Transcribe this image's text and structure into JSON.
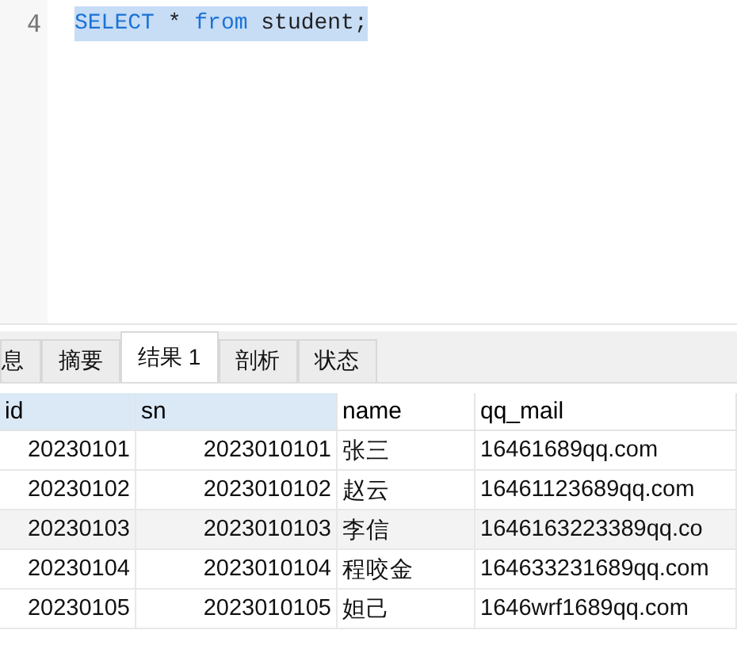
{
  "editor": {
    "lines": [
      {
        "number": "4",
        "tokens": [
          {
            "kind": "keyword",
            "text": "SELECT"
          },
          {
            "kind": "plain",
            "text": " * "
          },
          {
            "kind": "keyword",
            "text": "from"
          },
          {
            "kind": "plain",
            "text": " student;"
          }
        ],
        "selected": true
      }
    ]
  },
  "tabs": [
    {
      "label": "息",
      "selected": false
    },
    {
      "label": "摘要",
      "selected": false
    },
    {
      "label": "结果 1",
      "selected": true
    },
    {
      "label": "剖析",
      "selected": false
    },
    {
      "label": "状态",
      "selected": false
    }
  ],
  "table": {
    "columns": [
      {
        "label": "id",
        "selected": true
      },
      {
        "label": "sn",
        "selected": true
      },
      {
        "label": "name",
        "selected": false
      },
      {
        "label": "qq_mail",
        "selected": false
      }
    ],
    "rows": [
      {
        "cells": [
          "20230101",
          "2023010101",
          "张三",
          "16461689qq.com"
        ],
        "selected": false
      },
      {
        "cells": [
          "20230102",
          "2023010102",
          "赵云",
          "16461123689qq.com"
        ],
        "selected": false
      },
      {
        "cells": [
          "20230103",
          "2023010103",
          "李信",
          "1646163223389qq.co"
        ],
        "selected": true
      },
      {
        "cells": [
          "20230104",
          "2023010104",
          "程咬金",
          "164633231689qq.com"
        ],
        "selected": false
      },
      {
        "cells": [
          "20230105",
          "2023010105",
          "妲己",
          "1646wrf1689qq.com"
        ],
        "selected": false
      }
    ]
  }
}
